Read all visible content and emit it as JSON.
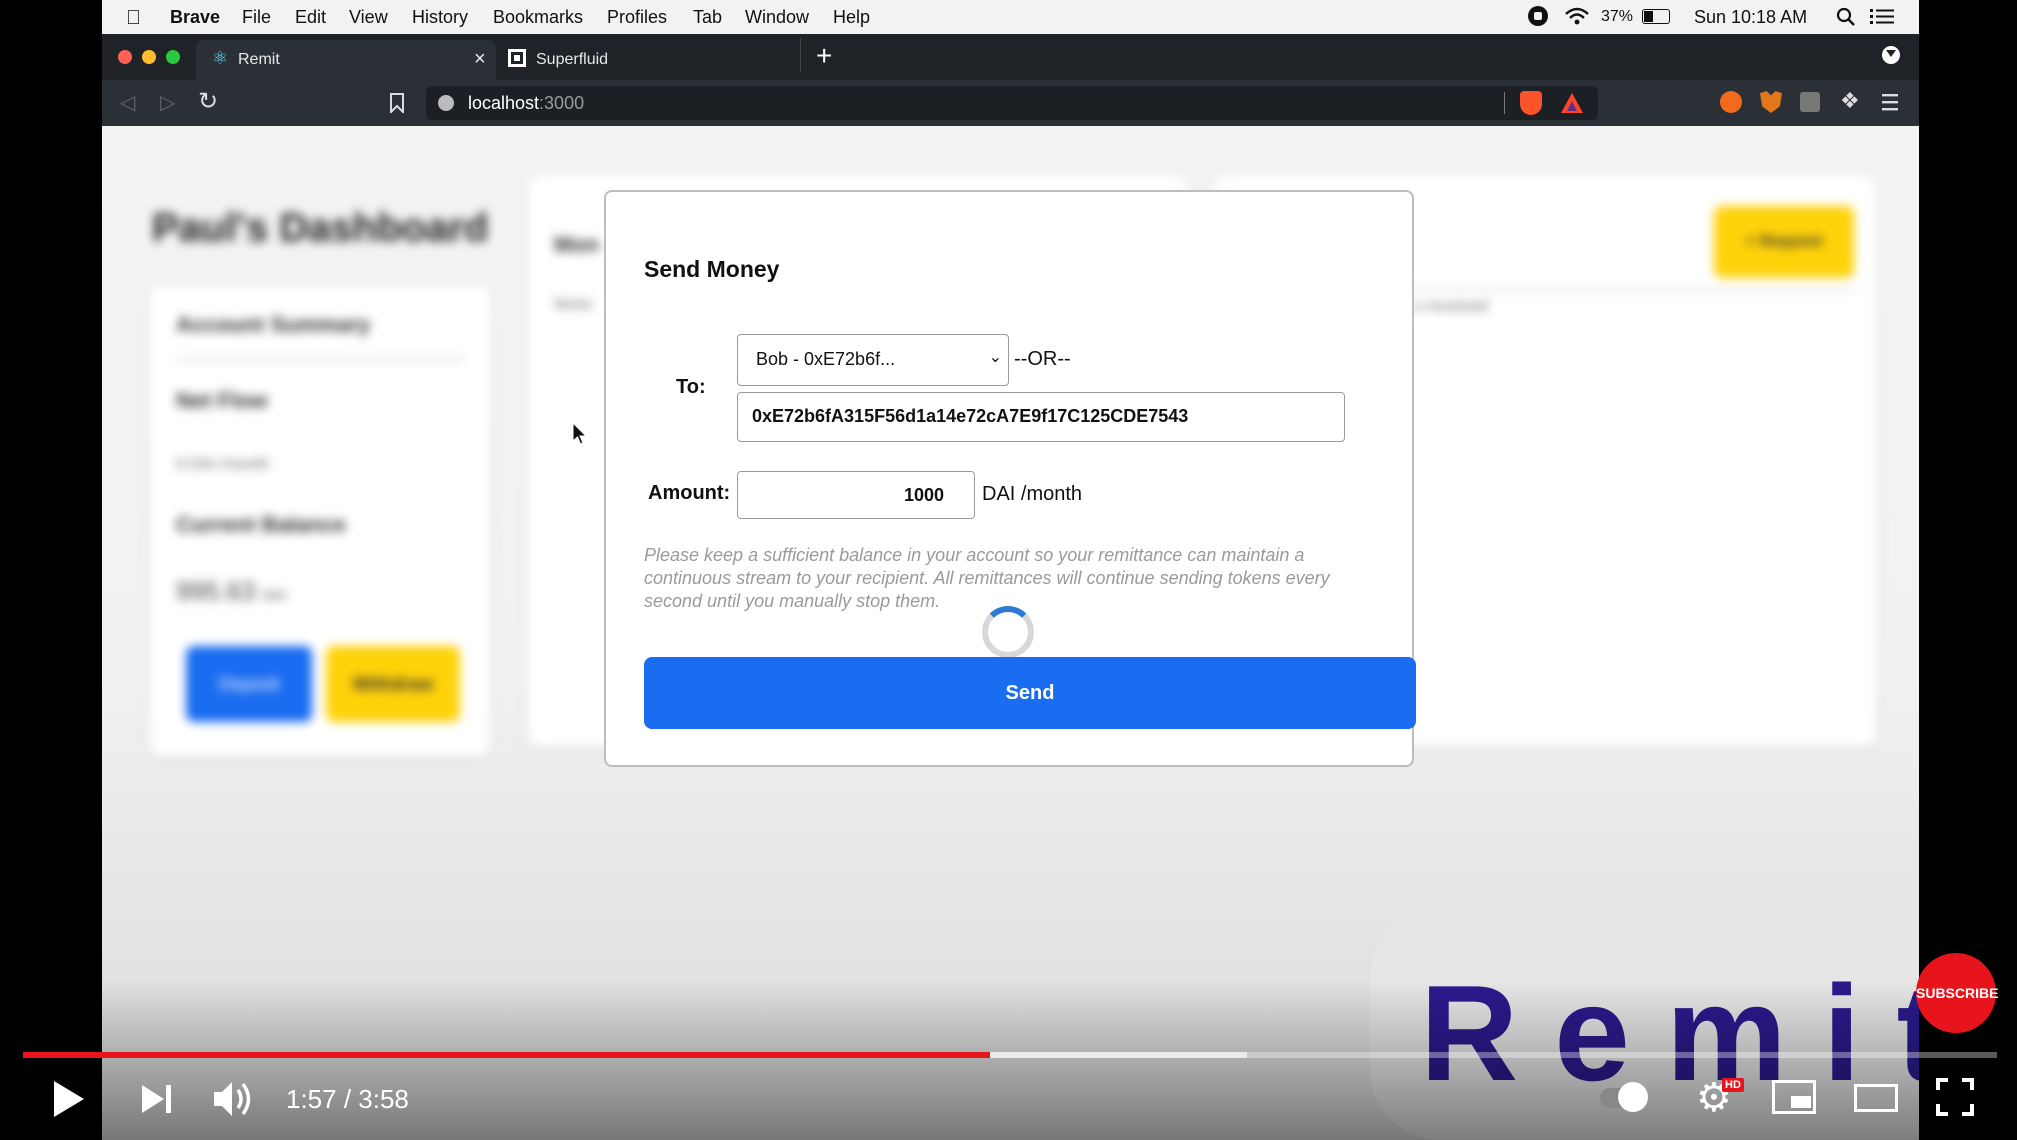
{
  "menubar": {
    "apple": "",
    "app": "Brave",
    "items": [
      "File",
      "Edit",
      "View",
      "History",
      "Bookmarks",
      "Profiles",
      "Tab",
      "Window",
      "Help"
    ],
    "battery": "37%",
    "clock": "Sun 10:18 AM"
  },
  "tabs": [
    {
      "title": "Remit",
      "active": true
    },
    {
      "title": "Superfluid",
      "active": false
    }
  ],
  "address": {
    "host": "localhost",
    "port": ":3000"
  },
  "dashboard": {
    "title": "Paul's Dashboard",
    "account_summary": "Account Summary",
    "net_flow": "Net Flow",
    "net_flow_value": "0 DAI /month",
    "current_balance": "Current Balance",
    "balance_value": "995.63",
    "balance_unit": "DAI",
    "deposit": "Deposit",
    "withdraw": "Withdraw",
    "money_title": "Mon",
    "money_note": "None",
    "request_button": "+ Request",
    "note_right": "e received"
  },
  "modal": {
    "title": "Send Money",
    "to_label": "To:",
    "recipient_selected": "Bob - 0xE72b6f...",
    "or_text": "--OR--",
    "address_value": "0xE72b6fA315F56d1a14e72cA7E9f17C125CDE7543",
    "amount_label": "Amount:",
    "amount_value": "1000",
    "amount_unit": "DAI /month",
    "notice": "Please keep a sufficient balance in your account so your remittance can maintain a continuous stream to your recipient. All remittances will continue sending tokens every second until you manually stop them.",
    "send_label": "Send"
  },
  "player": {
    "time": "1:57 / 3:58",
    "played_fraction": 0.49,
    "buffered_fraction": 0.62,
    "hd_badge": "HD",
    "subscribe": "SUBSCRIBE"
  },
  "watermark": {
    "text": "Remit"
  },
  "colors": {
    "accent": "#1a6cf0",
    "warn": "#ffd20a",
    "progress": "#e8141c",
    "brand_text": "#2a1a8c"
  }
}
